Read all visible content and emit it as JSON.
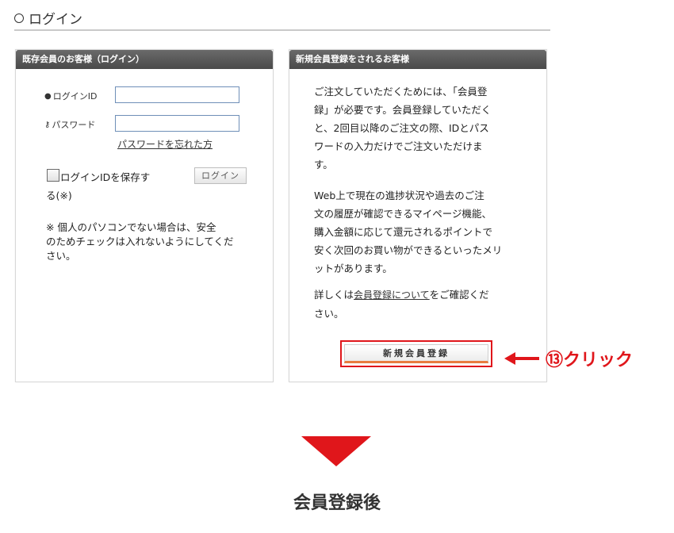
{
  "page": {
    "title": "ログイン"
  },
  "existing": {
    "header": "既存会員のお客様（ログイン）",
    "login_id_label": "ログインID",
    "password_label": "パスワード",
    "forgot_link": "パスワードを忘れた方",
    "save_id_label_1": "ログインIDを保存す",
    "save_id_label_2": "る(※)",
    "login_button": "ログイン",
    "login_id_value": "",
    "password_value": "",
    "note_lines": [
      "※ 個人のパソコンでない場合は、安全",
      "のためチェックは入れないようにしてくだ",
      "さい。"
    ]
  },
  "newreg": {
    "header": "新規会員登録をされるお客様",
    "para1_lines": [
      "ご注文していただくためには、「会員登",
      "録」が必要です。会員登録していただく",
      "と、2回目以降のご注文の際、IDとパス",
      "ワードの入力だけでご注文いただけま",
      "す。"
    ],
    "para2_lines": [
      "Web上で現在の進捗状況や過去のご注",
      "文の履歴が確認できるマイページ機能、",
      "購入金額に応じて還元されるポイントで",
      "安く次回のお買い物ができるといったメリ",
      "ットがあります。"
    ],
    "para3_prefix": "詳しくは",
    "para3_link": "会員登録について",
    "para3_suffix": "をご確認くだ",
    "para3_line2": "さい。",
    "register_button": "新規会員登録"
  },
  "annotation": {
    "text": "⑬クリック",
    "color": "#e0161b"
  },
  "after_label": "会員登録後"
}
